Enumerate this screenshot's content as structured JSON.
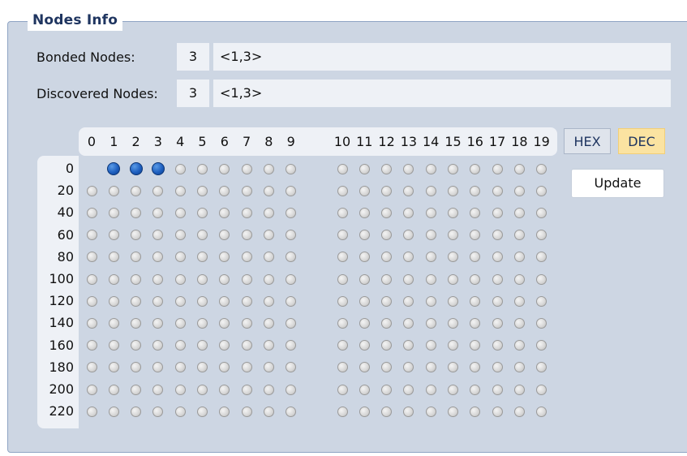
{
  "group": {
    "title": "Nodes Info"
  },
  "bonded": {
    "label": "Bonded Nodes:",
    "count": "3",
    "list": "<1,3>"
  },
  "discovered": {
    "label": "Discovered Nodes:",
    "count": "3",
    "list": "<1,3>"
  },
  "grid": {
    "column_labels": [
      "0",
      "1",
      "2",
      "3",
      "4",
      "5",
      "6",
      "7",
      "8",
      "9",
      "10",
      "11",
      "12",
      "13",
      "14",
      "15",
      "16",
      "17",
      "18",
      "19"
    ],
    "row_labels": [
      "0",
      "20",
      "40",
      "60",
      "80",
      "100",
      "120",
      "140",
      "160",
      "180",
      "200",
      "220"
    ],
    "active_nodes": [
      1,
      2,
      3
    ],
    "colors": {
      "active": "#1e5fbf",
      "inactive": "#d9d9d9"
    }
  },
  "format_toggle": {
    "hex_label": "HEX",
    "dec_label": "DEC",
    "selected": "DEC"
  },
  "update_button": {
    "label": "Update"
  }
}
